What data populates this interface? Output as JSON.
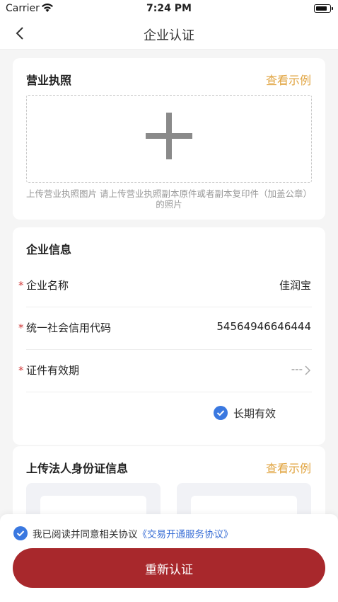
{
  "status": {
    "carrier": "Carrier",
    "time": "7:24 PM"
  },
  "nav": {
    "title": "企业认证"
  },
  "license": {
    "title": "营业执照",
    "example_link": "查看示例",
    "upload_hint": "上传营业执照图片 请上传营业执照副本原件或者副本复印件（加盖公章）的照片"
  },
  "info": {
    "title": "企业信息",
    "rows": [
      {
        "star": "*",
        "label": "企业名称",
        "value": "佳润宝"
      },
      {
        "star": "*",
        "label": "统一社会信用代码",
        "value": "54564946646444"
      },
      {
        "star": "*",
        "label": "证件有效期",
        "value": "---"
      }
    ],
    "long_term_label": "长期有效"
  },
  "idcard": {
    "title": "上传法人身份证信息",
    "example_link": "查看示例"
  },
  "agreement": {
    "prefix": "我已阅读并同意相关协议",
    "link": "《交易开通服务协议》"
  },
  "submit": {
    "label": "重新认证"
  },
  "colors": {
    "accent": "#e0a33e",
    "primary": "#a8282c",
    "link": "#3a6fd6",
    "check": "#3a78e0"
  }
}
